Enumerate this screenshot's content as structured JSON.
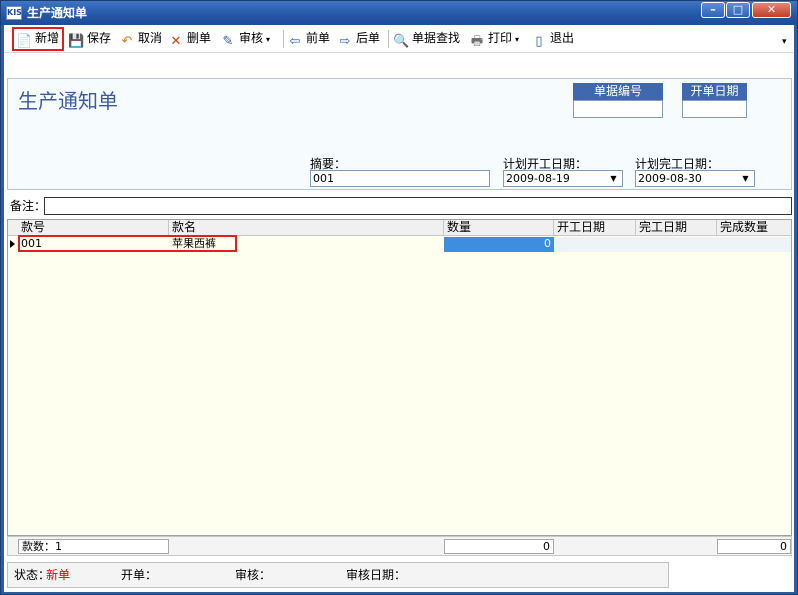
{
  "window": {
    "app_badge": "KIS",
    "title": "生产通知单",
    "controls": {
      "minimize": "–",
      "maximize": "□",
      "close": "✕"
    }
  },
  "toolbar": {
    "items": [
      {
        "label": "新增",
        "icon": "new-doc-icon",
        "glyph": "📄"
      },
      {
        "label": "保存",
        "icon": "save-icon",
        "glyph": "💾"
      },
      {
        "label": "取消",
        "icon": "cancel-icon",
        "glyph": "↶"
      },
      {
        "label": "删单",
        "icon": "delete-icon",
        "glyph": "✕"
      },
      {
        "label": "审核",
        "icon": "audit-icon",
        "glyph": "✎"
      },
      {
        "label": "前单",
        "icon": "prev-arrow-icon",
        "glyph": "⇦"
      },
      {
        "label": "后单",
        "icon": "next-arrow-icon",
        "glyph": "⇨"
      },
      {
        "label": "单据查找",
        "icon": "search-icon",
        "glyph": "🔍"
      },
      {
        "label": "打印",
        "icon": "printer-icon",
        "glyph": "🖶"
      },
      {
        "label": "退出",
        "icon": "exit-icon",
        "glyph": "▯"
      }
    ],
    "overflow_glyph": "▾"
  },
  "header": {
    "form_title": "生产通知单",
    "doc_no_label": "单据编号",
    "doc_no_value": "",
    "open_date_label": "开单日期",
    "open_date_value": "",
    "summary_label": "摘要：",
    "summary_value": "001",
    "plan_start_label": "计划开工日期：",
    "plan_start_value": "2009-08-19",
    "plan_end_label": "计划完工日期：",
    "plan_end_value": "2009-08-30",
    "dropdown_glyph": "▼"
  },
  "remark": {
    "label": "备注：",
    "value": ""
  },
  "grid": {
    "columns": [
      "款号",
      "款名",
      "数量",
      "开工日期",
      "完工日期",
      "完成数量"
    ],
    "rows": [
      {
        "code": "001",
        "name": "苹果西裤",
        "qty": "0",
        "start": "",
        "end": "",
        "done": ""
      }
    ]
  },
  "footer": {
    "count_label": "款数：",
    "count_value": "1",
    "qty_total": "0",
    "done_total": "0"
  },
  "status": {
    "state_label": "状态：",
    "state_value": "新单",
    "opener_label": "开单：",
    "auditor_label": "审核：",
    "audit_date_label": "审核日期："
  },
  "colors": {
    "title_bar": "#2558a8",
    "header_label_bg": "#3f68b0",
    "selected_cell": "#3d8ee0",
    "highlight_box": "#e02020",
    "status_new": "#e00000"
  }
}
